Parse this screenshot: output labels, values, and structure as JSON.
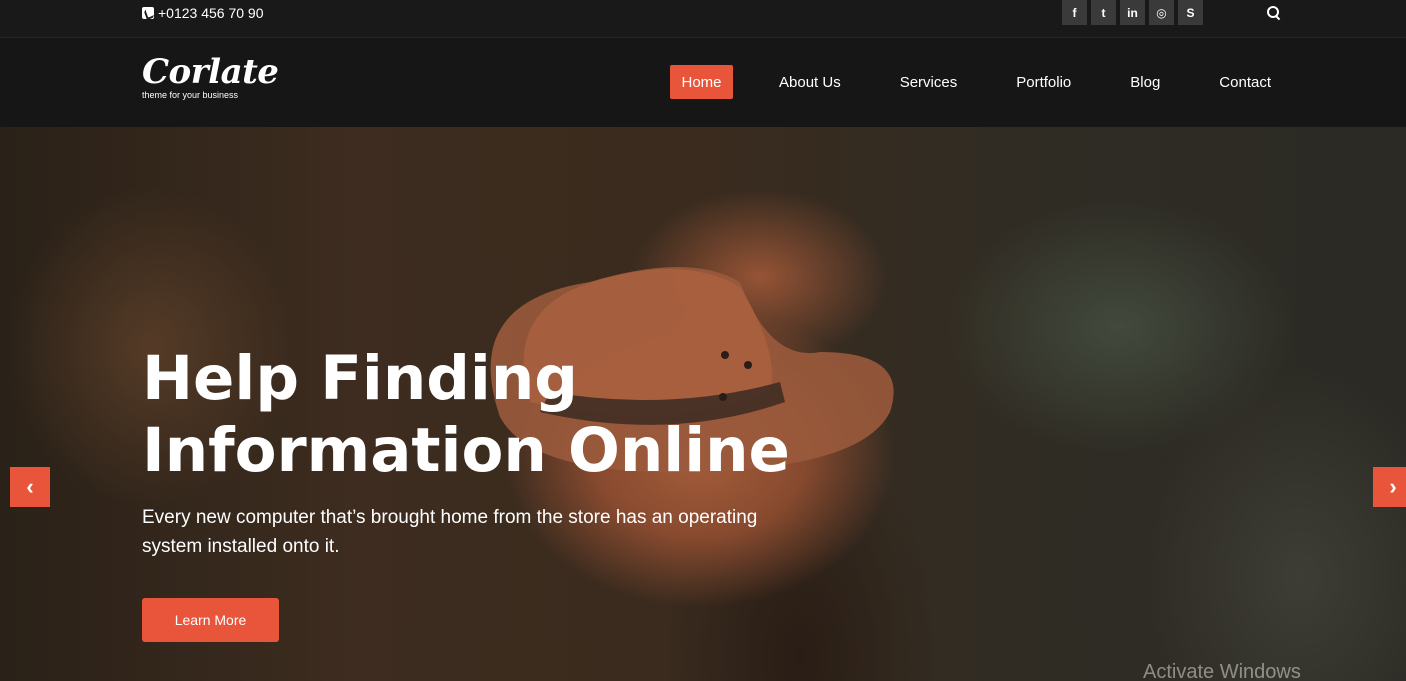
{
  "topbar": {
    "phone": "+0123 456 70 90",
    "social": [
      {
        "icon": "facebook-icon",
        "glyph": "f"
      },
      {
        "icon": "twitter-icon",
        "glyph": "t"
      },
      {
        "icon": "linkedin-icon",
        "glyph": "in"
      },
      {
        "icon": "dribbble-icon",
        "glyph": "◎"
      },
      {
        "icon": "skype-icon",
        "glyph": "S"
      }
    ]
  },
  "header": {
    "logo": "Corlate",
    "tagline": "theme for your business",
    "nav": [
      "Home",
      "About Us",
      "Services",
      "Portfolio",
      "Blog",
      "Contact"
    ]
  },
  "hero": {
    "title_line1": "Help Finding",
    "title_line2": "Information Online",
    "subtitle_line1": "Every new computer that’s brought home from the store has an operating",
    "subtitle_line2": "system installed onto it.",
    "button": "Learn More",
    "prev_glyph": "‹",
    "next_glyph": "›"
  },
  "watermark": "Activate Windows",
  "colors": {
    "accent": "#e8553a",
    "topbar": "#191919",
    "header": "#161616"
  }
}
